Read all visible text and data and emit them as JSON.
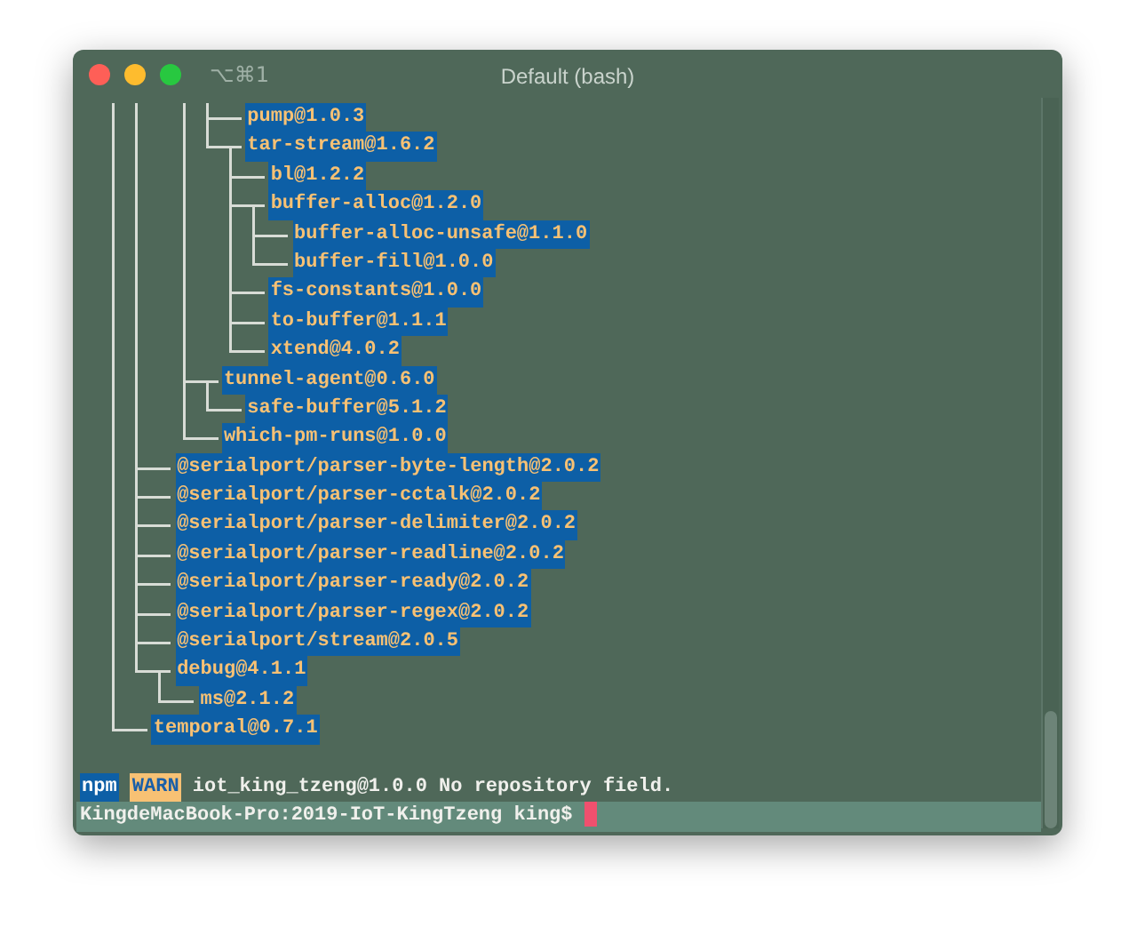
{
  "window": {
    "shortcut": "⌥⌘1",
    "title": "Default (bash)"
  },
  "tree": [
    {
      "children": [
        {
          "children": [
            {
              "children": [
                {
                  "children": [
                    {
                      "label": "pump@1.0.3",
                      "highlighted": true
                    },
                    {
                      "label": "tar-stream@1.6.2",
                      "highlighted": true,
                      "children": [
                        {
                          "label": "bl@1.2.2",
                          "highlighted": true
                        },
                        {
                          "label": "buffer-alloc@1.2.0",
                          "highlighted": true,
                          "children": [
                            {
                              "label": "buffer-alloc-unsafe@1.1.0",
                              "highlighted": true
                            },
                            {
                              "label": "buffer-fill@1.0.0",
                              "highlighted": true
                            }
                          ]
                        },
                        {
                          "label": "fs-constants@1.0.0",
                          "highlighted": true
                        },
                        {
                          "label": "to-buffer@1.1.1",
                          "highlighted": true
                        },
                        {
                          "label": "xtend@4.0.2",
                          "highlighted": true
                        }
                      ]
                    }
                  ]
                },
                {
                  "label": "tunnel-agent@0.6.0",
                  "highlighted": true,
                  "children": [
                    {
                      "label": "safe-buffer@5.1.2",
                      "highlighted": true
                    }
                  ]
                },
                {
                  "label": "which-pm-runs@1.0.0",
                  "highlighted": true
                }
              ]
            }
          ]
        },
        {
          "label": "@serialport/parser-byte-length@2.0.2",
          "highlighted": true
        },
        {
          "label": "@serialport/parser-cctalk@2.0.2",
          "highlighted": true
        },
        {
          "label": "@serialport/parser-delimiter@2.0.2",
          "highlighted": true
        },
        {
          "label": "@serialport/parser-readline@2.0.2",
          "highlighted": true
        },
        {
          "label": "@serialport/parser-ready@2.0.2",
          "highlighted": true
        },
        {
          "label": "@serialport/parser-regex@2.0.2",
          "highlighted": true
        },
        {
          "label": "@serialport/stream@2.0.5",
          "highlighted": true
        },
        {
          "label": "debug@4.1.1",
          "highlighted": true,
          "children": [
            {
              "label": "ms@2.1.2",
              "highlighted": true
            }
          ]
        }
      ]
    },
    {
      "label": "temporal@0.7.1",
      "highlighted": true
    }
  ],
  "warning": {
    "source": "npm",
    "severity": "WARN",
    "message": "iot_king_tzeng@1.0.0 No repository field."
  },
  "prompt": {
    "text": "KingdeMacBook-Pro:2019-IoT-KingTzeng king$"
  }
}
